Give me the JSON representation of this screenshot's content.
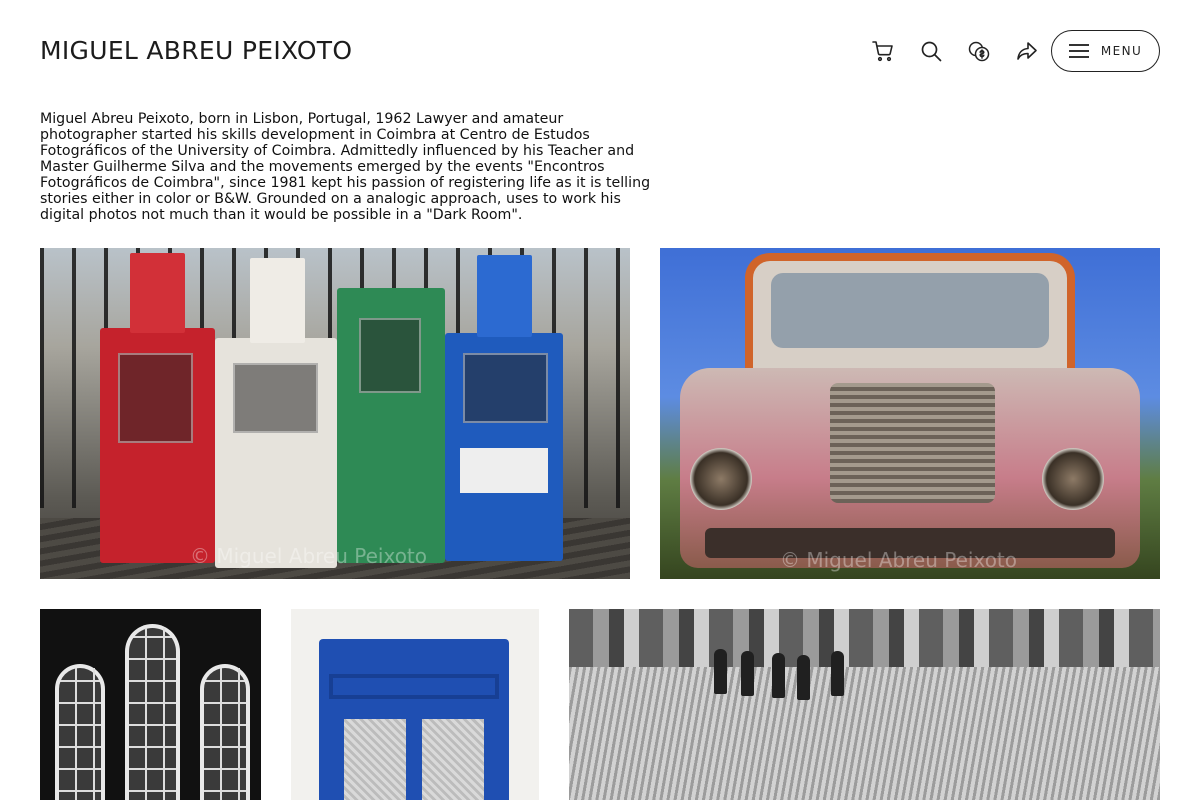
{
  "header": {
    "site_title": "MIGUEL ABREU PEIXOTO",
    "icons": [
      "cart-icon",
      "search-icon",
      "currency-icon",
      "share-icon"
    ],
    "menu_label": "MENU"
  },
  "bio": {
    "text": "Miguel Abreu Peixoto, born in Lisbon, Portugal, 1962 Lawyer and amateur photographer started his skills development in Coimbra at Centro de Estudos Fotográficos of the University of Coimbra. Admittedly influenced by his Teacher and Master Guilherme Silva and the movements emerged by the events \"Encontros Fotográficos de Coimbra\", since 1981 kept his passion of registering life as it is telling stories either in color or B&W. Grounded on a analogic approach, uses to work his digital photos not much than it would be possible in a \"Dark Room\"."
  },
  "gallery": {
    "watermark": "© Miguel Abreu Peixoto",
    "photos": [
      {
        "name": "newspaper-boxes"
      },
      {
        "name": "rusty-truck"
      },
      {
        "name": "arched-windows"
      },
      {
        "name": "blue-window"
      },
      {
        "name": "boardwalk"
      }
    ]
  },
  "colors": {
    "text": "#1a1a1a",
    "background": "#ffffff",
    "menu_border": "#222222"
  }
}
